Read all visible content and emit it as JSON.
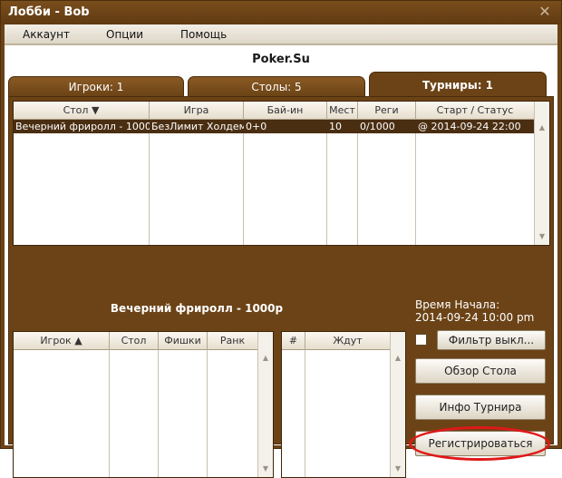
{
  "window": {
    "title": "Лобби - Bob",
    "close_glyph": "✕"
  },
  "menu": [
    "Аккаунт",
    "Опции",
    "Помощь"
  ],
  "brand": "Poker.Su",
  "tabs": [
    {
      "label": "Игроки: 1",
      "active": false
    },
    {
      "label": "Столы: 5",
      "active": false
    },
    {
      "label": "Турниры: 1",
      "active": true
    }
  ],
  "tournaments": {
    "columns": [
      "Стол ▼",
      "Игра",
      "Бай-ин",
      "Мест",
      "Реги",
      "Старт / Статус"
    ],
    "rows": [
      [
        "Вечерний фриролл - 1000р",
        "БезЛимит Холдем",
        "0+0",
        "10",
        "0/1000",
        "@ 2014-09-24 22:00"
      ]
    ]
  },
  "details": {
    "name": "Вечерний фриролл - 1000р",
    "start_label": "Время Начала:",
    "start_value": "2014-09-24 10:00 pm"
  },
  "players_table": {
    "columns": [
      "Игрок ▲",
      "Стол",
      "Фишки",
      "Ранк"
    ]
  },
  "waiting_table": {
    "columns": [
      "#",
      "Ждут"
    ]
  },
  "buttons": {
    "filter": "Фильтр выкл...",
    "table_overview": "Обзор Стола",
    "tournament_info": "Инфо Турнира",
    "register": "Регистрироваться"
  },
  "colors": {
    "frame": "#6b4316",
    "selected_row": "#4a2e12",
    "highlight": "#e01818"
  }
}
